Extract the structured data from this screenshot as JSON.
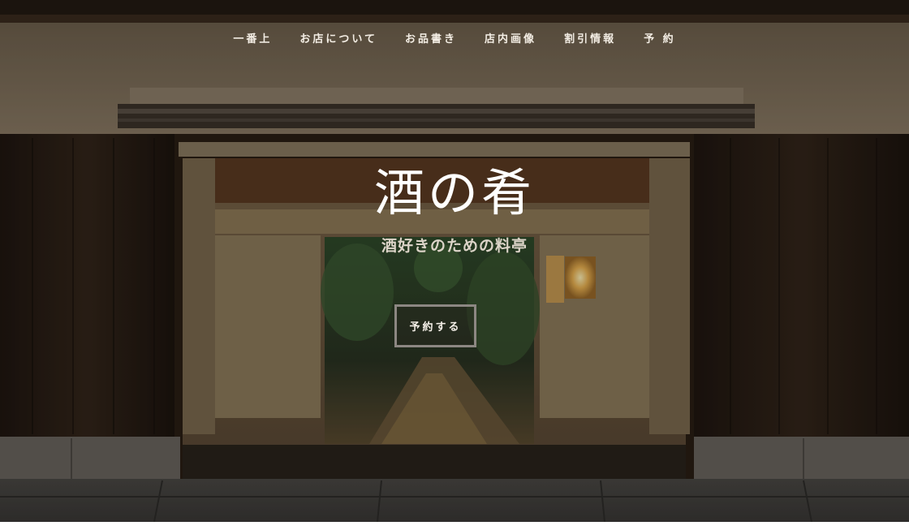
{
  "nav": {
    "items": [
      {
        "label": "一番上"
      },
      {
        "label": "お店について"
      },
      {
        "label": "お品書き"
      },
      {
        "label": "店内画像"
      },
      {
        "label": "割引情報"
      },
      {
        "label": "予 約"
      }
    ]
  },
  "hero": {
    "title": "酒の肴",
    "tagline": "酒好きのための料亭",
    "reserve_label": "予約する",
    "background_image": "restaurant-entrance-night-photo"
  },
  "colors": {
    "nav_text": "#f3ede4",
    "button_border": "#8c8782",
    "wall": "#8a7a64",
    "wood": "#2a1d14"
  }
}
